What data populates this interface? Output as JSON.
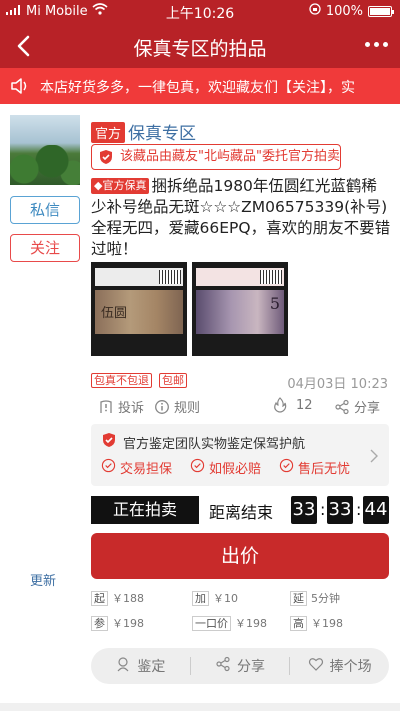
{
  "status_bar": {
    "carrier": "Mi Mobile",
    "time": "上午10:26",
    "battery": "100%"
  },
  "nav": {
    "title": "保真专区的拍品"
  },
  "notice": {
    "text": "本店好货多多，一律包真，欢迎藏友们【关注】，实"
  },
  "sidebar": {
    "message_label": "私信",
    "follow_label": "关注",
    "update_label": "更新"
  },
  "header": {
    "official_tag": "官方",
    "zone_title": "保真专区",
    "commission_text": "该藏品由藏友\"北屿藏品\"委托官方拍卖"
  },
  "item": {
    "badge": "官方保真",
    "title": "捆拆绝品1980年伍圆红光蓝鹤稀少补号绝品无斑☆☆☆ZM06575339(补号)全程无四，爱藏66EPQ，喜欢的朋友不要错过啦！",
    "photo1_caption": "伍圆",
    "photo2_caption": "5",
    "tags": [
      "包真不包退",
      "包邮"
    ],
    "time": "04月03日 10:23",
    "actions": {
      "report": "投诉",
      "rules": "规则",
      "heat": "12",
      "share": "分享"
    }
  },
  "guarantee": {
    "title": "官方鉴定团队实物鉴定保驾护航",
    "items": [
      "交易担保",
      "如假必赔",
      "售后无忧"
    ]
  },
  "auction": {
    "status": "正在拍卖",
    "countdown_label": "距离结束",
    "hours": "33",
    "minutes": "33",
    "seconds": "44",
    "bid_label": "出价"
  },
  "params": [
    {
      "k": "起",
      "v": "￥188"
    },
    {
      "k": "加",
      "v": "￥10"
    },
    {
      "k": "延",
      "v": "5分钟"
    },
    {
      "k": "参",
      "v": "￥198"
    },
    {
      "k": "一口价",
      "v": "￥198"
    },
    {
      "k": "高",
      "v": "￥198"
    }
  ],
  "bottom": {
    "appraise": "鉴定",
    "share": "分享",
    "support": "捧个场"
  },
  "colors": {
    "brand_red": "#b82227",
    "notice_red": "#f03a3a",
    "link_blue": "#3e6fa3",
    "accent_red": "#e23b33"
  }
}
